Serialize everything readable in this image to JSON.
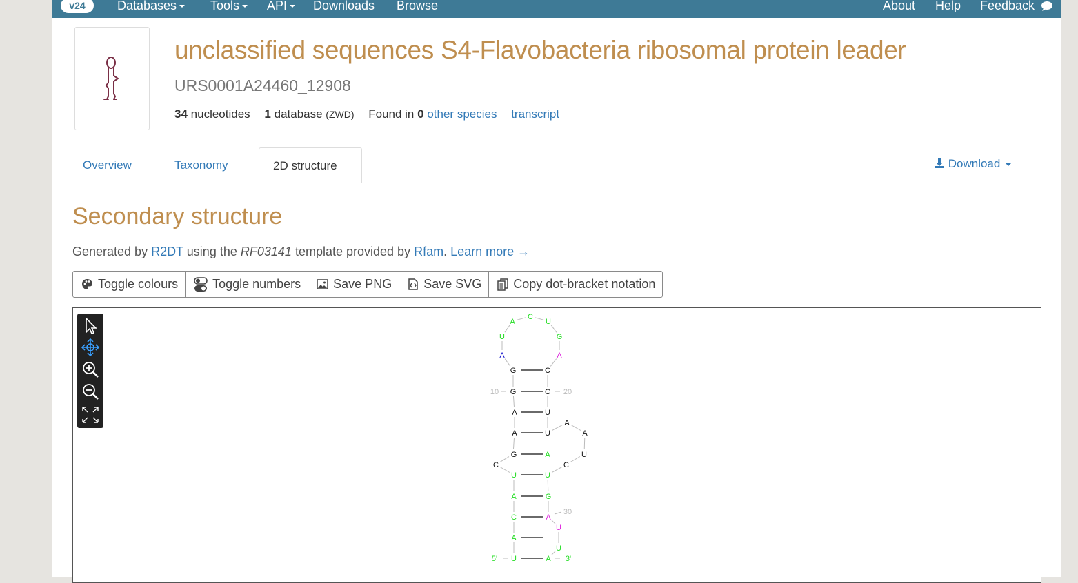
{
  "navbar": {
    "version": "v24",
    "items": [
      "Databases",
      "Tools",
      "API",
      "Downloads",
      "Browse"
    ],
    "right_items": [
      "About",
      "Help",
      "Feedback"
    ]
  },
  "header": {
    "title": "unclassified sequences S4-Flavobacteria ribosomal protein leader",
    "urs": "URS0001A24460_12908",
    "nucleotides_count": "34",
    "nucleotides_label": "nucleotides",
    "database_count": "1",
    "database_label": "database",
    "database_code": "(ZWD)",
    "found_in_label": "Found in",
    "found_in_count": "0",
    "other_species_link": "other species",
    "transcript_link": "transcript"
  },
  "tabs": {
    "overview": "Overview",
    "taxonomy": "Taxonomy",
    "structure": "2D structure",
    "download": "Download"
  },
  "secondary": {
    "title": "Secondary structure",
    "generated_by": "Generated by",
    "r2dt_link": "R2DT",
    "using_the": "using the",
    "template_id": "RF03141",
    "template_provided_by": "template provided by",
    "rfam_link": "Rfam",
    "learn_more": "Learn more →"
  },
  "buttons": {
    "toggle_colours": "Toggle colours",
    "toggle_numbers": "Toggle numbers",
    "save_png": "Save PNG",
    "save_svg": "Save SVG",
    "copy_dot_bracket": "Copy dot-bracket notation"
  },
  "colors": {
    "navbar": "#3e7a96",
    "title": "#bf8e4f",
    "link": "#337ab7",
    "green": "#22dd22",
    "magenta": "#dd22dd",
    "blue": "#1111cc"
  },
  "structure": {
    "nucleotides": [
      {
        "n": "U",
        "color": "green"
      },
      {
        "n": "A",
        "color": "green"
      },
      {
        "n": "C",
        "color": "green"
      },
      {
        "n": "A",
        "color": "green"
      },
      {
        "n": "U",
        "color": "green"
      },
      {
        "n": "C",
        "color": "black"
      },
      {
        "n": "G",
        "color": "black"
      },
      {
        "n": "A",
        "color": "black"
      },
      {
        "n": "A",
        "color": "black"
      },
      {
        "n": "G",
        "color": "black"
      },
      {
        "n": "G",
        "color": "black"
      },
      {
        "n": "A",
        "color": "blue"
      },
      {
        "n": "U",
        "color": "green"
      },
      {
        "n": "A",
        "color": "green"
      },
      {
        "n": "C",
        "color": "green"
      },
      {
        "n": "U",
        "color": "green"
      },
      {
        "n": "G",
        "color": "green"
      },
      {
        "n": "A",
        "color": "magenta"
      },
      {
        "n": "C",
        "color": "black"
      },
      {
        "n": "C",
        "color": "black"
      },
      {
        "n": "U",
        "color": "black"
      },
      {
        "n": "U",
        "color": "black"
      },
      {
        "n": "A",
        "color": "black"
      },
      {
        "n": "A",
        "color": "black"
      },
      {
        "n": "U",
        "color": "black"
      },
      {
        "n": "C",
        "color": "black"
      },
      {
        "n": "A",
        "color": "green"
      },
      {
        "n": "U",
        "color": "green"
      },
      {
        "n": "G",
        "color": "green"
      },
      {
        "n": "A",
        "color": "magenta"
      },
      {
        "n": "U",
        "color": "magenta"
      },
      {
        "n": "U",
        "color": "green"
      },
      {
        "n": "A",
        "color": "green"
      }
    ],
    "labels": {
      "five_prime": "5'",
      "three_prime": "3'",
      "n10": "10",
      "n20": "20",
      "n30": "30"
    }
  }
}
